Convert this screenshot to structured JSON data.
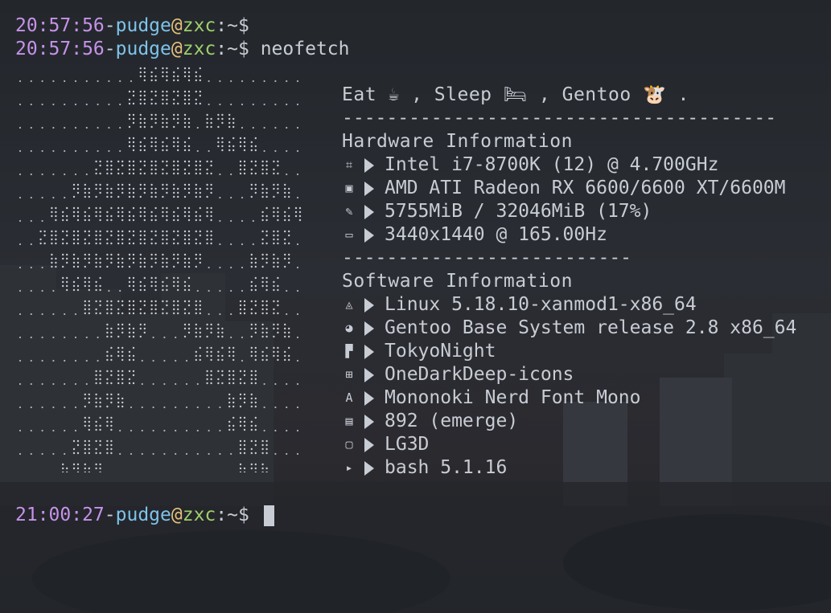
{
  "prompt": {
    "time1": "20:57:56",
    "time2": "20:57:56",
    "time3": "21:00:27",
    "user": "pudge",
    "at": "@",
    "host": "zxc",
    "path": ":~$",
    "command": "neofetch"
  },
  "header": {
    "title": "Eat ☕ , Sleep 🛏 , Gentoo 🐮 .",
    "separator": "---------------------------------------"
  },
  "hardware": {
    "title": "Hardware Information",
    "items": [
      {
        "icon": "cpu-icon",
        "glyph": "⌗",
        "value": "Intel i7-8700K (12) @ 4.700GHz"
      },
      {
        "icon": "gpu-icon",
        "glyph": "▣",
        "value": "AMD ATI Radeon RX 6600/6600 XT/6600M"
      },
      {
        "icon": "memory-icon",
        "glyph": "✎",
        "value": "5755MiB / 32046MiB (17%)"
      },
      {
        "icon": "monitor-icon",
        "glyph": "▭",
        "value": "3440x1440 @ 165.00Hz"
      }
    ],
    "separator": "--------------------------"
  },
  "software": {
    "title": "Software Information",
    "items": [
      {
        "icon": "linux-icon",
        "glyph": "◬",
        "value": "Linux 5.18.10-xanmod1-x86_64"
      },
      {
        "icon": "gentoo-icon",
        "glyph": "◕",
        "value": "Gentoo Base System release 2.8 x86_64"
      },
      {
        "icon": "theme-icon",
        "glyph": "▛",
        "value": "TokyoNight"
      },
      {
        "icon": "icons-icon",
        "glyph": "⊞",
        "value": "OneDarkDeep-icons"
      },
      {
        "icon": "font-icon",
        "glyph": "A",
        "value": "Mononoki Nerd Font Mono"
      },
      {
        "icon": "packages-icon",
        "glyph": "▤",
        "value": "892 (emerge)"
      },
      {
        "icon": "wm-icon",
        "glyph": "▢",
        "value": "LG3D"
      },
      {
        "icon": "terminal-icon",
        "glyph": "▸",
        "value": "bash 5.1.16"
      }
    ]
  },
  "colors": {
    "time": "#c792ea",
    "user": "#7ec3ea",
    "at": "#e6c07b",
    "host": "#9ece6a",
    "text": "#c8ccd4",
    "background": "#22262b"
  }
}
